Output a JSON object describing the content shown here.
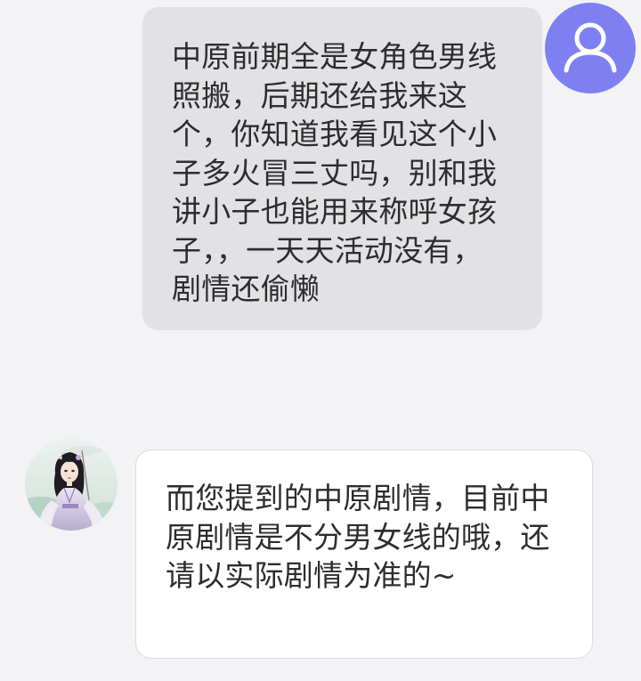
{
  "conversation": {
    "messages": [
      {
        "sender": "user",
        "text": "中原前期全是女角色男线照搬，后期还给我来这个，你知道我看见这个小子多火冒三丈吗，别和我讲小子也能用来称呼女孩子，，一天天活动没有，剧情还偷懒"
      },
      {
        "sender": "agent",
        "text": "而您提到的中原剧情，目前中原剧情是不分男女线的哦，还请以实际剧情为准的~"
      }
    ]
  },
  "icons": {
    "user_avatar": "user-silhouette-icon",
    "agent_avatar": "character-portrait"
  },
  "colors": {
    "background": "#f3f3f5",
    "user_bubble": "#e2e2e4",
    "agent_bubble": "#ffffff",
    "user_avatar_bg": "#7e80f2",
    "text": "#2d2d2f"
  }
}
